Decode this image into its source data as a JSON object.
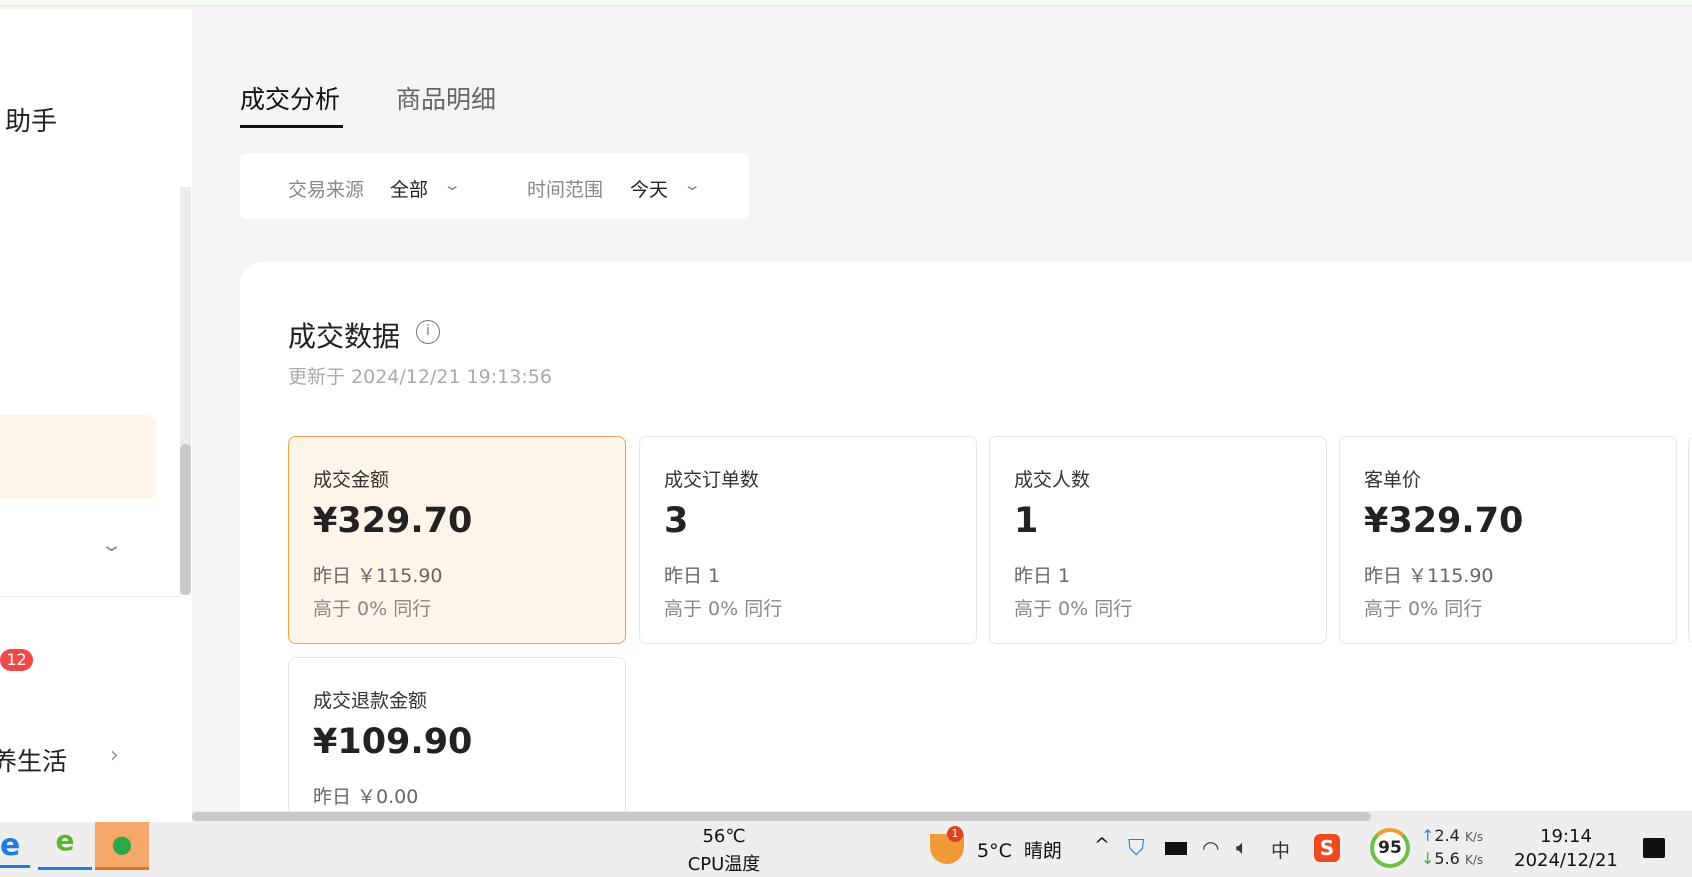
{
  "sidebar": {
    "title_partial": "助手",
    "badge": "12",
    "item_partial": "养生活"
  },
  "tabs": [
    {
      "label": "成交分析",
      "active": true
    },
    {
      "label": "商品明细",
      "active": false
    }
  ],
  "filters": [
    {
      "label": "交易来源",
      "value": "全部"
    },
    {
      "label": "时间范围",
      "value": "今天"
    }
  ],
  "section": {
    "title": "成交数据",
    "updated": "更新于 2024/12/21 19:13:56"
  },
  "metrics": [
    {
      "label": "成交金额",
      "value": "¥329.70",
      "yesterday": "昨日 ￥115.90",
      "compare": "高于 0% 同行",
      "selected": true
    },
    {
      "label": "成交订单数",
      "value": "3",
      "yesterday": "昨日 1",
      "compare": "高于 0% 同行"
    },
    {
      "label": "成交人数",
      "value": "1",
      "yesterday": "昨日 1",
      "compare": "高于 0% 同行"
    },
    {
      "label": "客单价",
      "value": "¥329.70",
      "yesterday": "昨日 ￥115.90",
      "compare": "高于 0% 同行"
    },
    {
      "label": "成交退款金额",
      "value": "¥109.90",
      "yesterday": "昨日 ￥0.00"
    }
  ],
  "taskbar": {
    "cpu_temp": "56℃",
    "cpu_label": "CPU温度",
    "weather_badge": "1",
    "weather": "5°C  晴朗",
    "ime": "中",
    "score": "95",
    "up": "2.4",
    "down": "5.6",
    "unit": "K/s",
    "time": "19:14",
    "date": "2024/12/21"
  },
  "colors": {
    "accent": "#f0a14e",
    "selected_bg": "#fdf5ea",
    "badge": "#f04848"
  }
}
